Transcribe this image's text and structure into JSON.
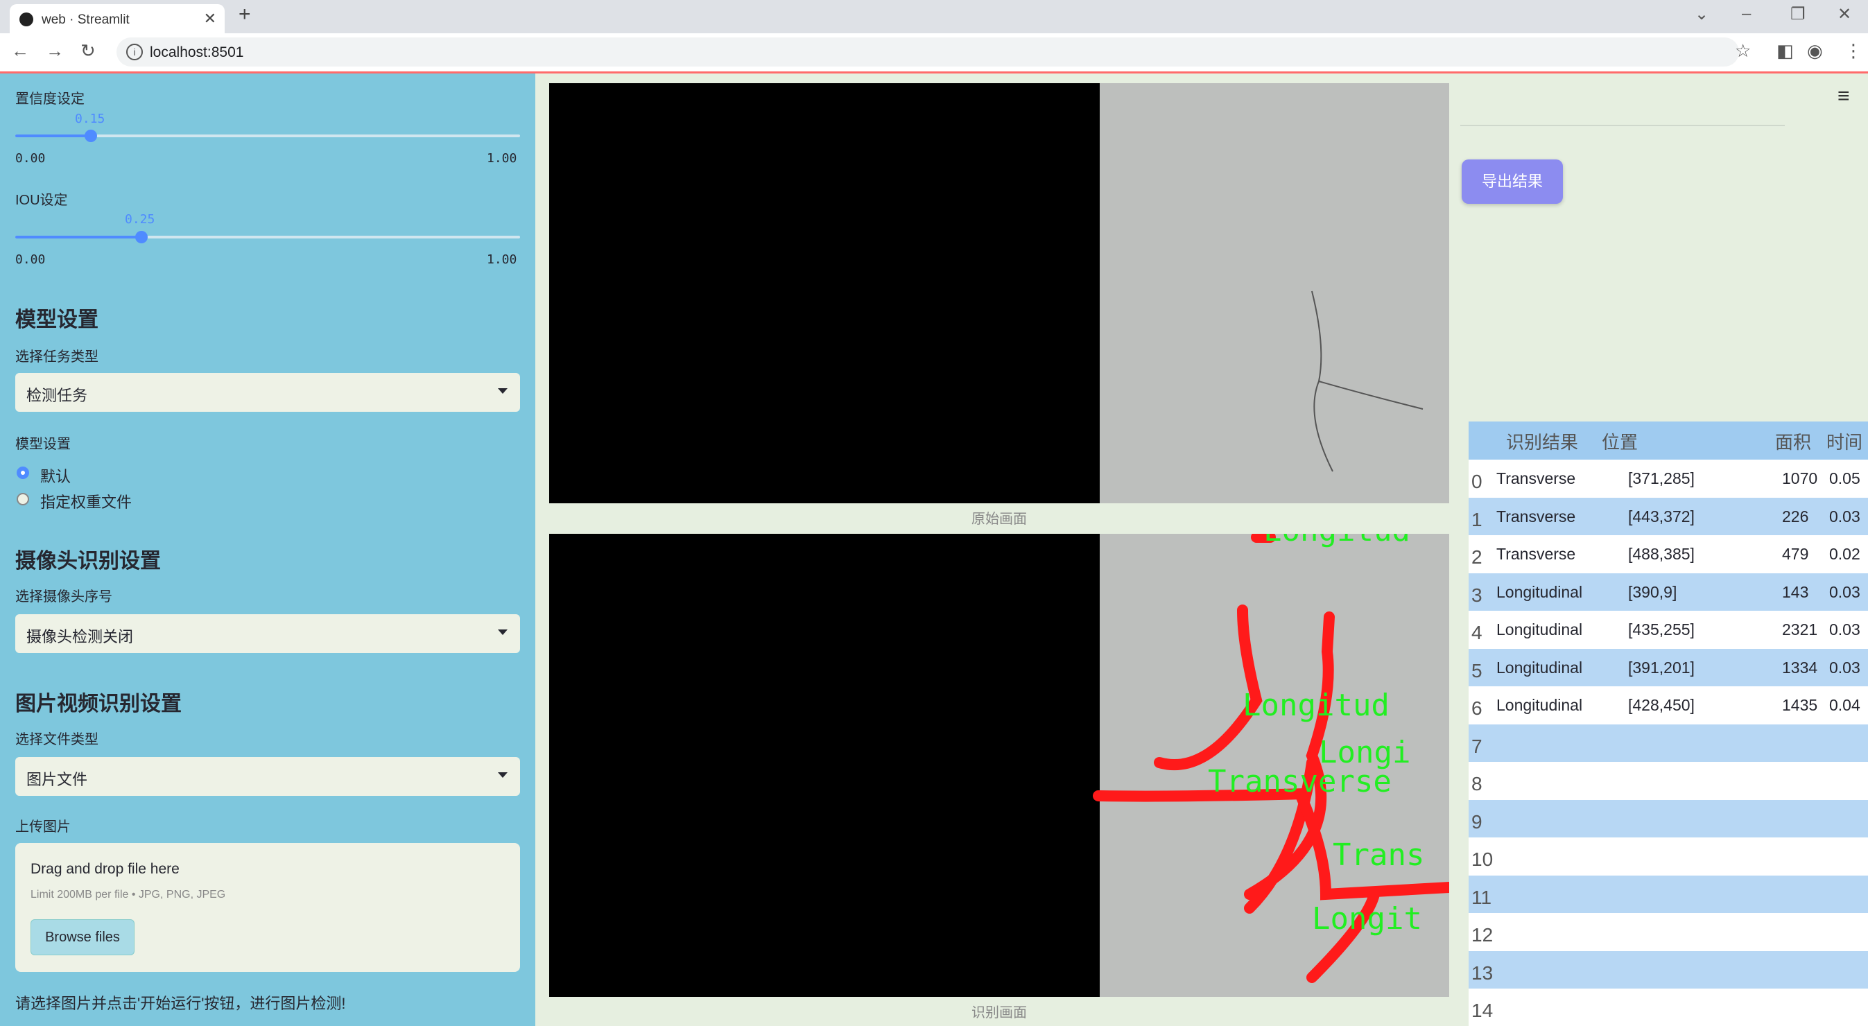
{
  "browser": {
    "tab_title": "web · Streamlit",
    "url": "localhost:8501"
  },
  "sidebar": {
    "confidence": {
      "label": "置信度设定",
      "value": "0.15",
      "min": "0.00",
      "max": "1.00",
      "fraction": 0.15
    },
    "iou": {
      "label": "IOU设定",
      "value": "0.25",
      "min": "0.00",
      "max": "1.00",
      "fraction": 0.25
    },
    "model_section": {
      "title": "模型设置",
      "task_label": "选择任务类型",
      "task_value": "检测任务",
      "model_label": "模型设置",
      "radio_options": [
        "默认",
        "指定权重文件"
      ],
      "radio_selected": 0
    },
    "camera_section": {
      "title": "摄像头识别设置",
      "label": "选择摄像头序号",
      "value": "摄像头检测关闭"
    },
    "file_section": {
      "title": "图片视频识别设置",
      "label": "选择文件类型",
      "value": "图片文件"
    },
    "upload": {
      "label": "上传图片",
      "drag_text": "Drag and drop file here",
      "limit_text": "Limit 200MB per file • JPG, PNG, JPEG",
      "browse_label": "Browse files"
    },
    "hint": "请选择图片并点击'开始运行'按钮，进行图片检测!"
  },
  "main": {
    "original_caption": "原始画面",
    "result_caption": "识别画面",
    "export_label": "导出结果",
    "overlay_labels": [
      "Longitud",
      "Longitud",
      "Longi",
      "Transverse",
      "Trans",
      "Longit"
    ],
    "colors": {
      "accent": "#4f8bff",
      "sidebar": "#7ec7dd",
      "export": "#8c8cf0",
      "mask": "#ff1a1a",
      "label": "#22ee22"
    }
  },
  "table": {
    "headers": [
      "识别结果",
      "位置",
      "面积",
      "时间"
    ],
    "rows": [
      {
        "idx": "0",
        "result": "Transverse",
        "pos": "[371,285]",
        "area": "1070",
        "time": "0.05"
      },
      {
        "idx": "1",
        "result": "Transverse",
        "pos": "[443,372]",
        "area": "226",
        "time": "0.03"
      },
      {
        "idx": "2",
        "result": "Transverse",
        "pos": "[488,385]",
        "area": "479",
        "time": "0.02"
      },
      {
        "idx": "3",
        "result": "Longitudinal",
        "pos": "[390,9]",
        "area": "143",
        "time": "0.03"
      },
      {
        "idx": "4",
        "result": "Longitudinal",
        "pos": "[435,255]",
        "area": "2321",
        "time": "0.03"
      },
      {
        "idx": "5",
        "result": "Longitudinal",
        "pos": "[391,201]",
        "area": "1334",
        "time": "0.03"
      },
      {
        "idx": "6",
        "result": "Longitudinal",
        "pos": "[428,450]",
        "area": "1435",
        "time": "0.04"
      },
      {
        "idx": "7",
        "result": "",
        "pos": "",
        "area": "",
        "time": ""
      },
      {
        "idx": "8",
        "result": "",
        "pos": "",
        "area": "",
        "time": ""
      },
      {
        "idx": "9",
        "result": "",
        "pos": "",
        "area": "",
        "time": ""
      },
      {
        "idx": "10",
        "result": "",
        "pos": "",
        "area": "",
        "time": ""
      },
      {
        "idx": "11",
        "result": "",
        "pos": "",
        "area": "",
        "time": ""
      },
      {
        "idx": "12",
        "result": "",
        "pos": "",
        "area": "",
        "time": ""
      },
      {
        "idx": "13",
        "result": "",
        "pos": "",
        "area": "",
        "time": ""
      },
      {
        "idx": "14",
        "result": "",
        "pos": "",
        "area": "",
        "time": ""
      }
    ]
  }
}
